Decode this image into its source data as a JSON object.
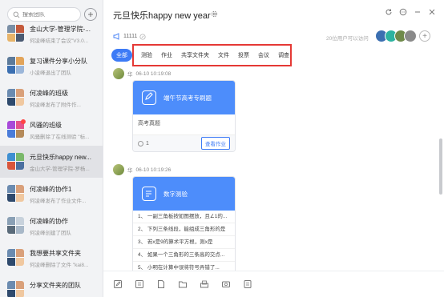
{
  "sidebar": {
    "search_placeholder": "搜索团队",
    "items": [
      {
        "title": "金山大学-管理学院-...",
        "sub": "何凌峰结束了会议\"V3.0...",
        "colors": [
          "#7a8fa6",
          "#c45a3c",
          "#e7b46a",
          "#4a5a72"
        ],
        "active": false,
        "dot": false
      },
      {
        "title": "复习课件分享小分队",
        "sub": "小凌峰退出了团队",
        "colors": [
          "#5c7a9a",
          "#e2a45a",
          "#3b6fb1",
          "#9bb6d9"
        ],
        "active": false,
        "dot": false
      },
      {
        "title": "何凌峰的班级",
        "sub": "何凌峰发布了附件作...",
        "colors": [
          "#6b8bb0",
          "#d9a07a",
          "#2f4a6d",
          "#f0c8a0"
        ],
        "active": false,
        "dot": false
      },
      {
        "title": "风骚的班级",
        "sub": "风骚删除了在线测验 \"标...",
        "colors": [
          "#a84ad9",
          "#e5538c",
          "#4a7cd9",
          "#b58a5a"
        ],
        "active": false,
        "dot": true
      },
      {
        "title": "元旦快乐happy new...",
        "sub": "金山大学-管理学院-罗杨...",
        "colors": [
          "#3e8fd1",
          "#7ab86a",
          "#d9553b",
          "#4a6fa0"
        ],
        "active": true,
        "dot": false
      },
      {
        "title": "何凌峰的协作1",
        "sub": "何凌峰发布了作业文件...",
        "colors": [
          "#6b8bb0",
          "#d9a07a",
          "#2f4a6d",
          "#f0c8a0"
        ],
        "active": false,
        "dot": false
      },
      {
        "title": "何凌峰的协作",
        "sub": "何凌峰创建了团队",
        "colors": [
          "#8aa0b5",
          "#c8d2dc",
          "#5a6b7a",
          "#a8b8c8"
        ],
        "active": false,
        "dot": false
      },
      {
        "title": "我想要共享文件夹",
        "sub": "何凌峰删除了文件 \"kai8...",
        "colors": [
          "#6b8bb0",
          "#d9a07a",
          "#2f4a6d",
          "#f0c8a0"
        ],
        "active": false,
        "dot": false
      },
      {
        "title": "分享文件夹的团队",
        "sub": "",
        "colors": [
          "#6b8bb0",
          "#d9a07a",
          "#2f4a6d",
          "#f0c8a0"
        ],
        "active": false,
        "dot": false
      }
    ]
  },
  "main": {
    "title": "元旦快乐happy new year",
    "announce_id": "11111",
    "online_text": "20位用户可以访问",
    "member_colors": [
      "#3b6fb1",
      "#2db3a0",
      "#6f8a4a",
      "#8a8a8a"
    ],
    "tabs": [
      "全部",
      "测验",
      "作业",
      "共享文件夹",
      "文件",
      "投票",
      "会议",
      "调查"
    ],
    "posts": [
      {
        "author": "华",
        "time": "06-10 10:19:08",
        "card_title": "端午节高考专刷题",
        "body": "高考真题",
        "count": "1",
        "action": "查看作业"
      },
      {
        "author": "华",
        "time": "06-10 10:19:26",
        "card_title": "数字测验",
        "questions": [
          "1、 一副三角板按如图摆放，且∠1的...",
          "2、 下列三条线段，能组成三角形的是",
          "3、 若x是9的算术平方根，则x是",
          "4、 如果一个三角形的三条高的交点...",
          "5、 小明在计算中误将符号弄错了..."
        ]
      }
    ]
  },
  "colors": {
    "accent": "#3d7bf6",
    "highlight": "#e53935",
    "banner": "#4d8dfb"
  }
}
